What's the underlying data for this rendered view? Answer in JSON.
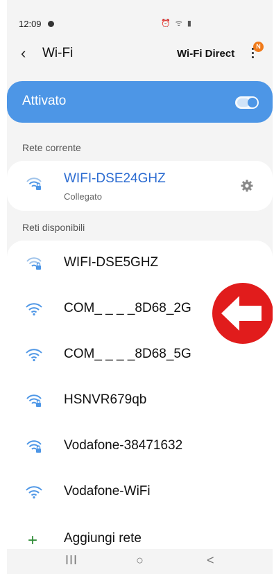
{
  "status_bar": {
    "time": "12:09",
    "icons": "⏰ ᯤ ▮"
  },
  "app_bar": {
    "title": "Wi-Fi",
    "action": "Wi-Fi Direct",
    "badge": "N"
  },
  "master_switch": {
    "label": "Attivato",
    "state": "on"
  },
  "current_section": {
    "header": "Rete corrente",
    "network": {
      "name": "WIFI-DSE24GHZ",
      "status": "Collegato",
      "secured": true
    }
  },
  "available_section": {
    "header": "Reti disponibili",
    "networks": [
      {
        "name": "WIFI-DSE5GHZ",
        "secured": true
      },
      {
        "name": "COM_ _ _ _8D68_2G",
        "secured": false
      },
      {
        "name": "COM_ _ _ _8D68_5G",
        "secured": false
      },
      {
        "name": "HSNVR679qb",
        "secured": true
      },
      {
        "name": "Vodafone-38471632",
        "secured": true
      },
      {
        "name": "Vodafone-WiFi",
        "secured": false
      }
    ],
    "add_network": "Aggiungi rete"
  },
  "nav_bar": {
    "recent": "III",
    "home": "○",
    "back": "<"
  },
  "colors": {
    "accent": "#4d96e6",
    "link": "#2b6bd1",
    "annotation": "#e11c1c"
  }
}
